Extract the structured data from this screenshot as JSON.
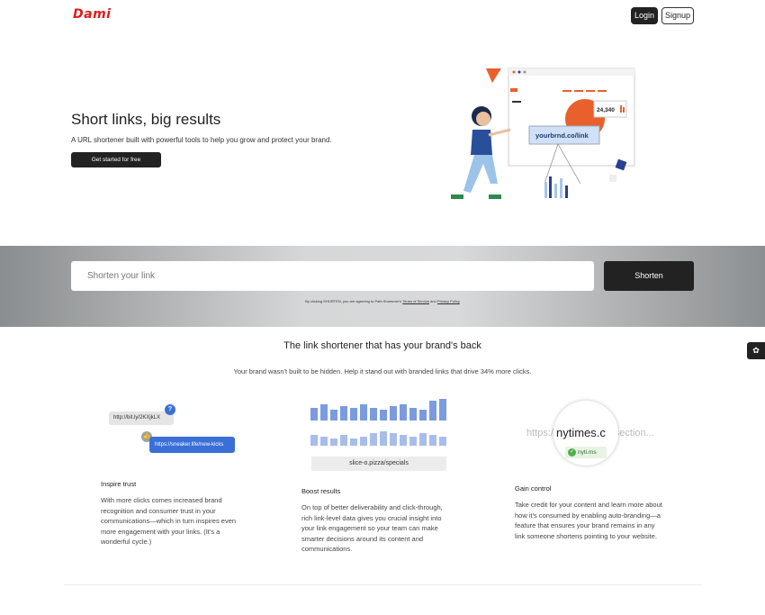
{
  "header": {
    "logo": "Dami",
    "login_label": "Login",
    "signup_label": "Signup"
  },
  "hero": {
    "title": "Short links, big results",
    "subtitle": "A URL shortener built with powerful tools to help you grow and protect your brand.",
    "cta_label": "Get started for free",
    "illustration": {
      "link_text": "yourbrnd.co/link",
      "count": "24,340"
    }
  },
  "shorten": {
    "placeholder": "Shorten your link",
    "button_label": "Shorten",
    "disclaimer_prefix": "By clicking SHORTEN, you are agreeing to Path Shortener's",
    "terms_label": "Terms of Service",
    "and_text": "and",
    "privacy_label": "Privacy Policy"
  },
  "section": {
    "title": "The link shortener that has your brand's back",
    "subtitle": "Your brand wasn't built to be hidden. Help it stand out with branded links that drive 34% more clicks."
  },
  "features": [
    {
      "title": "Inspire trust",
      "body": "With more clicks comes increased brand recognition and consumer trust in your communications—which in turn inspires even more engagement with your links. (It's a wonderful cycle.)",
      "graphic": {
        "link_a": "http://bit.ly/2KXjkLX",
        "link_b": "https://sneaker.life/new-kicks"
      }
    },
    {
      "title": "Boost results",
      "body": "On top of better deliverability and click-through, rich link-level data gives you crucial insight into your link engagement so your team can make smarter decisions around its content and communications.",
      "graphic": {
        "slice": "slice-o.pizza/specials"
      }
    },
    {
      "title": "Gain control",
      "body": "Take credit for your content and learn more about how it's consumed by enabling auto-branding—a feature that ensures your brand remains in any link someone shortens pointing to your website.",
      "graphic": {
        "long_url": "https://nytimes.com/section...",
        "big": "nytimes.c",
        "short": "nyti.ms"
      }
    }
  ],
  "colors": {
    "accent": "#e11b1b",
    "dark": "#222222",
    "chart_blue": "#7b9be0",
    "link_blue": "#3a6fd8"
  },
  "side_widget": {
    "icon": "leaf-icon"
  }
}
